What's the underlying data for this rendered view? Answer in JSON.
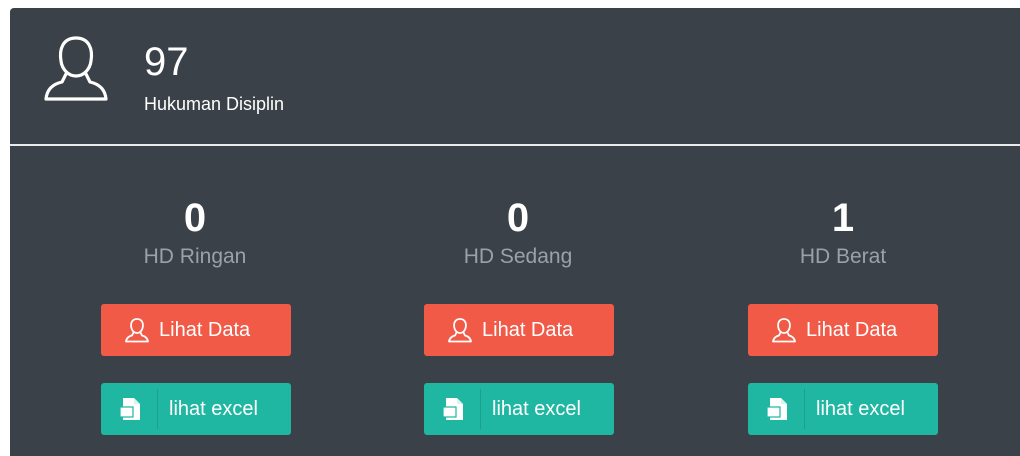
{
  "summary": {
    "icon": "user-icon",
    "count": "97",
    "label": "Hukuman Disiplin"
  },
  "categories": [
    {
      "value": "0",
      "label": "HD Ringan",
      "view_button": "Lihat Data",
      "excel_button": "lihat excel"
    },
    {
      "value": "0",
      "label": "HD Sedang",
      "view_button": "Lihat Data",
      "excel_button": "lihat excel"
    },
    {
      "value": "1",
      "label": "HD Berat",
      "view_button": "Lihat Data",
      "excel_button": "lihat excel"
    }
  ],
  "colors": {
    "panel_background": "#3b4148",
    "view_button": "#f15a47",
    "excel_button": "#1fb6a2"
  }
}
